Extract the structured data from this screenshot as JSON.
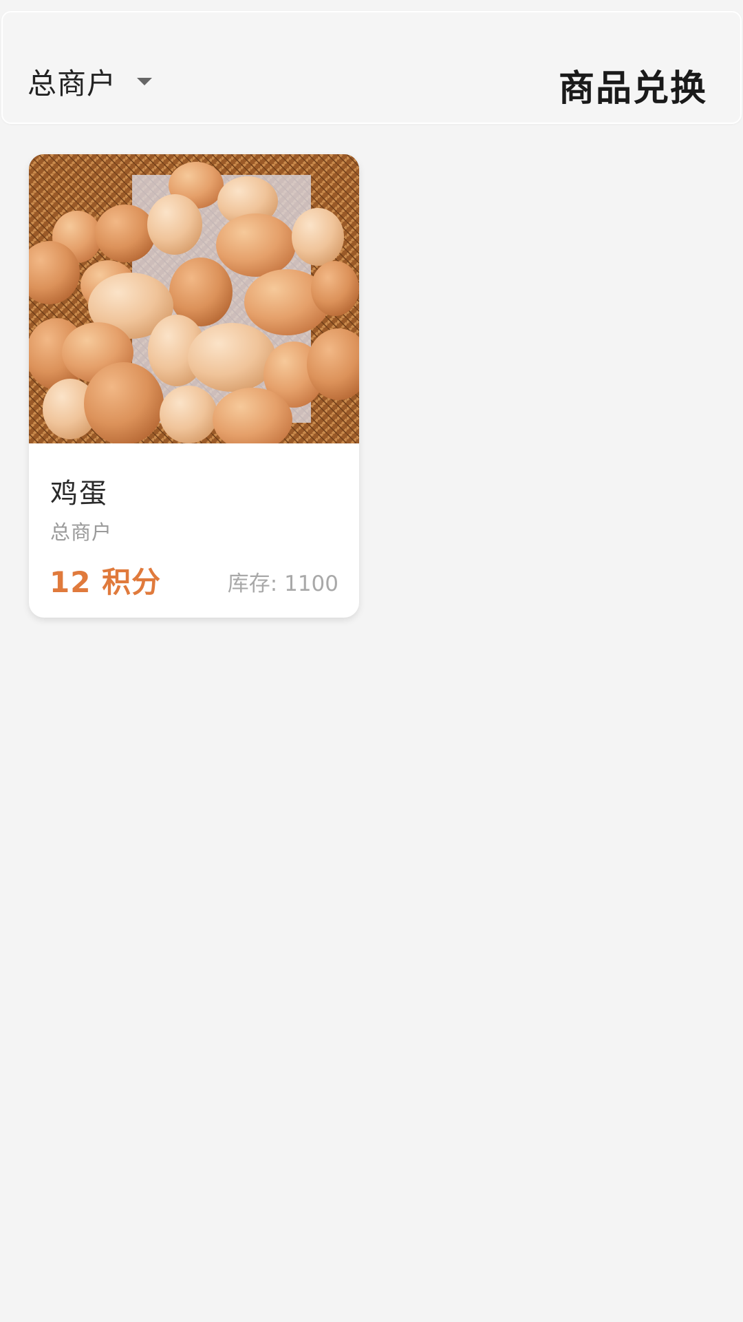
{
  "header": {
    "merchant_label": "总商户",
    "title": "商品兑换"
  },
  "products": [
    {
      "image_icon": "eggs-in-basket-photo",
      "name": "鸡蛋",
      "merchant": "总商户",
      "points": "12 积分",
      "stock": "库存: 1100"
    }
  ],
  "colors": {
    "accent": "#e07a3c",
    "background": "#f4f4f4",
    "card": "#ffffff"
  }
}
